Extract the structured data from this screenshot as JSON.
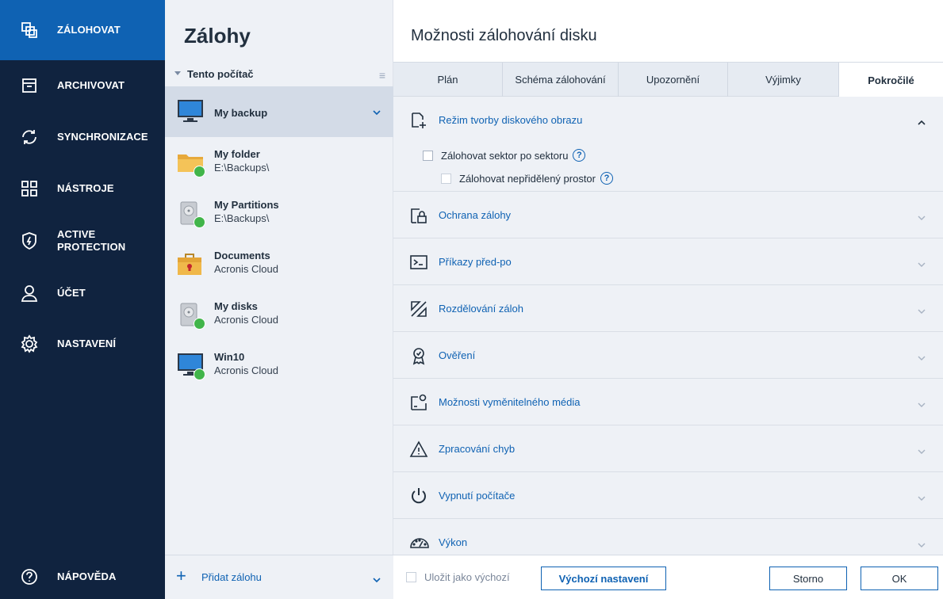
{
  "nav": {
    "items": [
      {
        "label": "ZÁLOHOVAT",
        "icon": "backup-icon"
      },
      {
        "label": "ARCHIVOVAT",
        "icon": "archive-icon"
      },
      {
        "label": "SYNCHRONIZACE",
        "icon": "sync-icon"
      },
      {
        "label": "NÁSTROJE",
        "icon": "tools-icon"
      },
      {
        "label": "ACTIVE PROTECTION",
        "icon": "shield-icon"
      },
      {
        "label": "ÚČET",
        "icon": "account-icon"
      },
      {
        "label": "NASTAVENÍ",
        "icon": "gear-icon"
      }
    ],
    "help_label": "NÁPOVĚDA",
    "active_color": "#0f62b3",
    "bg_color": "#10233f"
  },
  "list": {
    "title": "Zálohy",
    "group": "Tento počítač",
    "backups": [
      {
        "name": "My backup",
        "sub": "",
        "icon": "monitor-icon"
      },
      {
        "name": "My folder",
        "sub": "E:\\Backups\\",
        "icon": "folder-icon"
      },
      {
        "name": "My Partitions",
        "sub": "E:\\Backups\\",
        "icon": "disk-icon"
      },
      {
        "name": "Documents",
        "sub": "Acronis Cloud",
        "icon": "briefcase-icon"
      },
      {
        "name": "My disks",
        "sub": "Acronis Cloud",
        "icon": "disk-icon"
      },
      {
        "name": "Win10",
        "sub": "Acronis Cloud",
        "icon": "monitor-icon"
      }
    ],
    "add_label": "Přidat zálohu"
  },
  "panel": {
    "title": "Možnosti zálohování disku",
    "tabs": [
      "Plán",
      "Schéma zálohování",
      "Upozornění",
      "Výjimky",
      "Pokročilé"
    ],
    "active_tab": "Pokročilé",
    "sections": [
      {
        "label": "Režim tvorby diskového obrazu",
        "icon": "disk-image-icon"
      },
      {
        "label": "Ochrana zálohy",
        "icon": "lock-icon"
      },
      {
        "label": "Příkazy před-po",
        "icon": "terminal-icon"
      },
      {
        "label": "Rozdělování záloh",
        "icon": "split-icon"
      },
      {
        "label": "Ověření",
        "icon": "badge-icon"
      },
      {
        "label": "Možnosti vyměnitelného média",
        "icon": "removable-media-icon"
      },
      {
        "label": "Zpracování chyb",
        "icon": "warning-icon"
      },
      {
        "label": "Vypnutí počítače",
        "icon": "power-icon"
      },
      {
        "label": "Výkon",
        "icon": "speedometer-icon"
      }
    ],
    "options": {
      "sector_by_sector": "Zálohovat sektor po sektoru",
      "unallocated": "Zálohovat nepřidělený prostor",
      "help_glyph": "?"
    },
    "footer": {
      "save_default": "Uložit jako výchozí",
      "default_settings": "Výchozí nastavení",
      "cancel": "Storno",
      "ok": "OK"
    }
  }
}
